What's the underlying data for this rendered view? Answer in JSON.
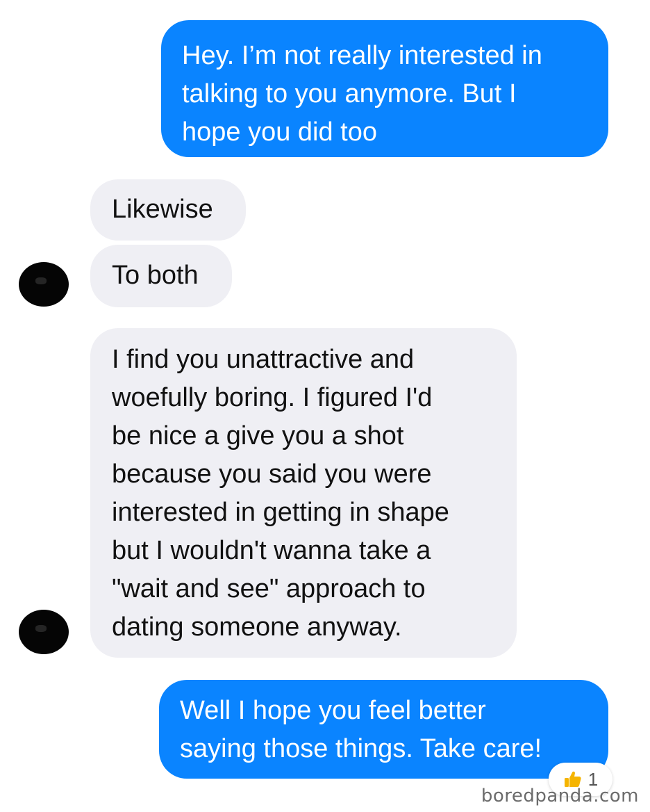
{
  "colors": {
    "outgoing_bubble": "#0a84ff",
    "incoming_bubble": "#efeff4",
    "reaction_thumb": "#f5b400"
  },
  "messages": [
    {
      "direction": "outgoing",
      "text": "Hey. I’m not really interested in\ntalking to you anymore. But I\nhope you did too"
    },
    {
      "direction": "incoming",
      "text": "Likewise"
    },
    {
      "direction": "incoming",
      "text": "To both"
    },
    {
      "direction": "incoming",
      "text": "I find you unattractive and\nwoefully boring. I figured I'd\nbe nice a give you a shot\nbecause you said you were\ninterested in getting in shape\nbut I wouldn't wanna take a\n\"wait and see\" approach to\ndating someone anyway."
    },
    {
      "direction": "outgoing",
      "text": "Well I hope you feel better\nsaying those things. Take care!"
    }
  ],
  "reaction": {
    "icon": "thumbs-up-icon",
    "count": "1"
  },
  "watermark": "boredpanda.com"
}
